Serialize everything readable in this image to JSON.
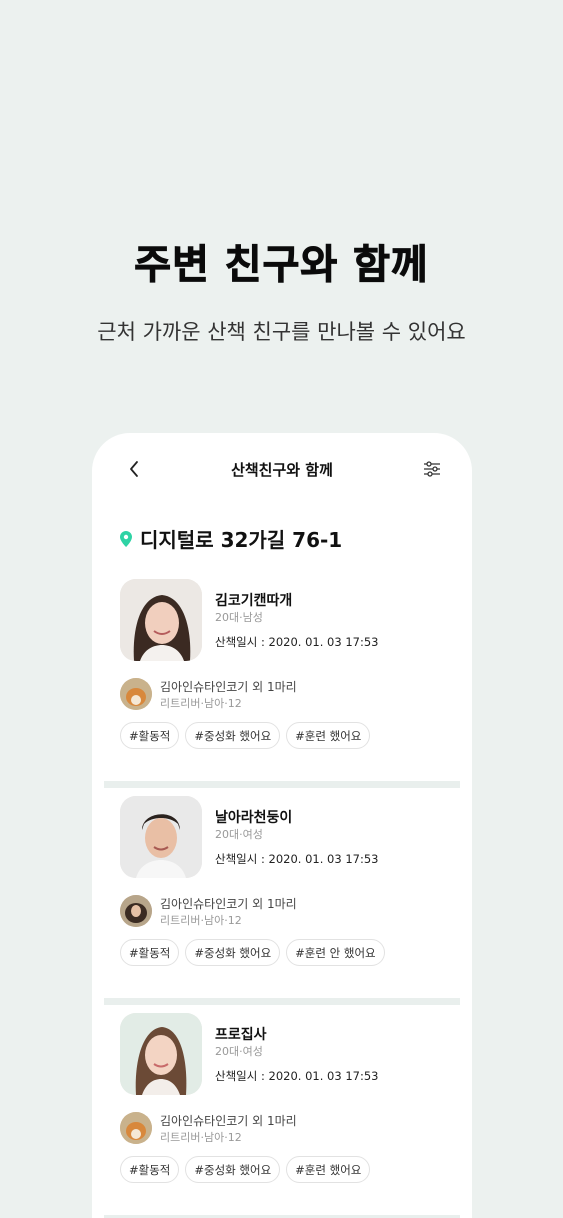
{
  "hero": {
    "title": "주변 친구와 함께",
    "subtitle": "근처 가까운 산책 친구를 만나볼 수 있어요"
  },
  "topbar": {
    "title": "산책친구와 함께",
    "back_icon": "chevron-left-icon",
    "filter_icon": "sliders-icon"
  },
  "location": {
    "address": "디지털로 32가길 76-1",
    "icon_color": "#2fd3a5"
  },
  "friends": [
    {
      "name": "김코기캔따개",
      "meta": "20대·남성",
      "walk_date": "산책일시  : 2020. 01. 03 17:53",
      "pet_name": "김아인슈타인코기 외 1마리",
      "pet_meta": "리트리버·남아·12",
      "tags": [
        "#활동적",
        "#중성화 했어요",
        "#훈련 했어요"
      ]
    },
    {
      "name": "날아라천둥이",
      "meta": "20대·여성",
      "walk_date": "산책일시  : 2020. 01. 03 17:53",
      "pet_name": "김아인슈타인코기 외 1마리",
      "pet_meta": "리트리버·남아·12",
      "tags": [
        "#활동적",
        "#중성화 했어요",
        "#훈련 안 했어요"
      ]
    },
    {
      "name": "프로집사",
      "meta": "20대·여성",
      "walk_date": "산책일시  : 2020. 01. 03 17:53",
      "pet_name": "김아인슈타인코기 외 1마리",
      "pet_meta": "리트리버·남아·12",
      "tags": [
        "#활동적",
        "#중성화 했어요",
        "#훈련 했어요"
      ]
    }
  ]
}
